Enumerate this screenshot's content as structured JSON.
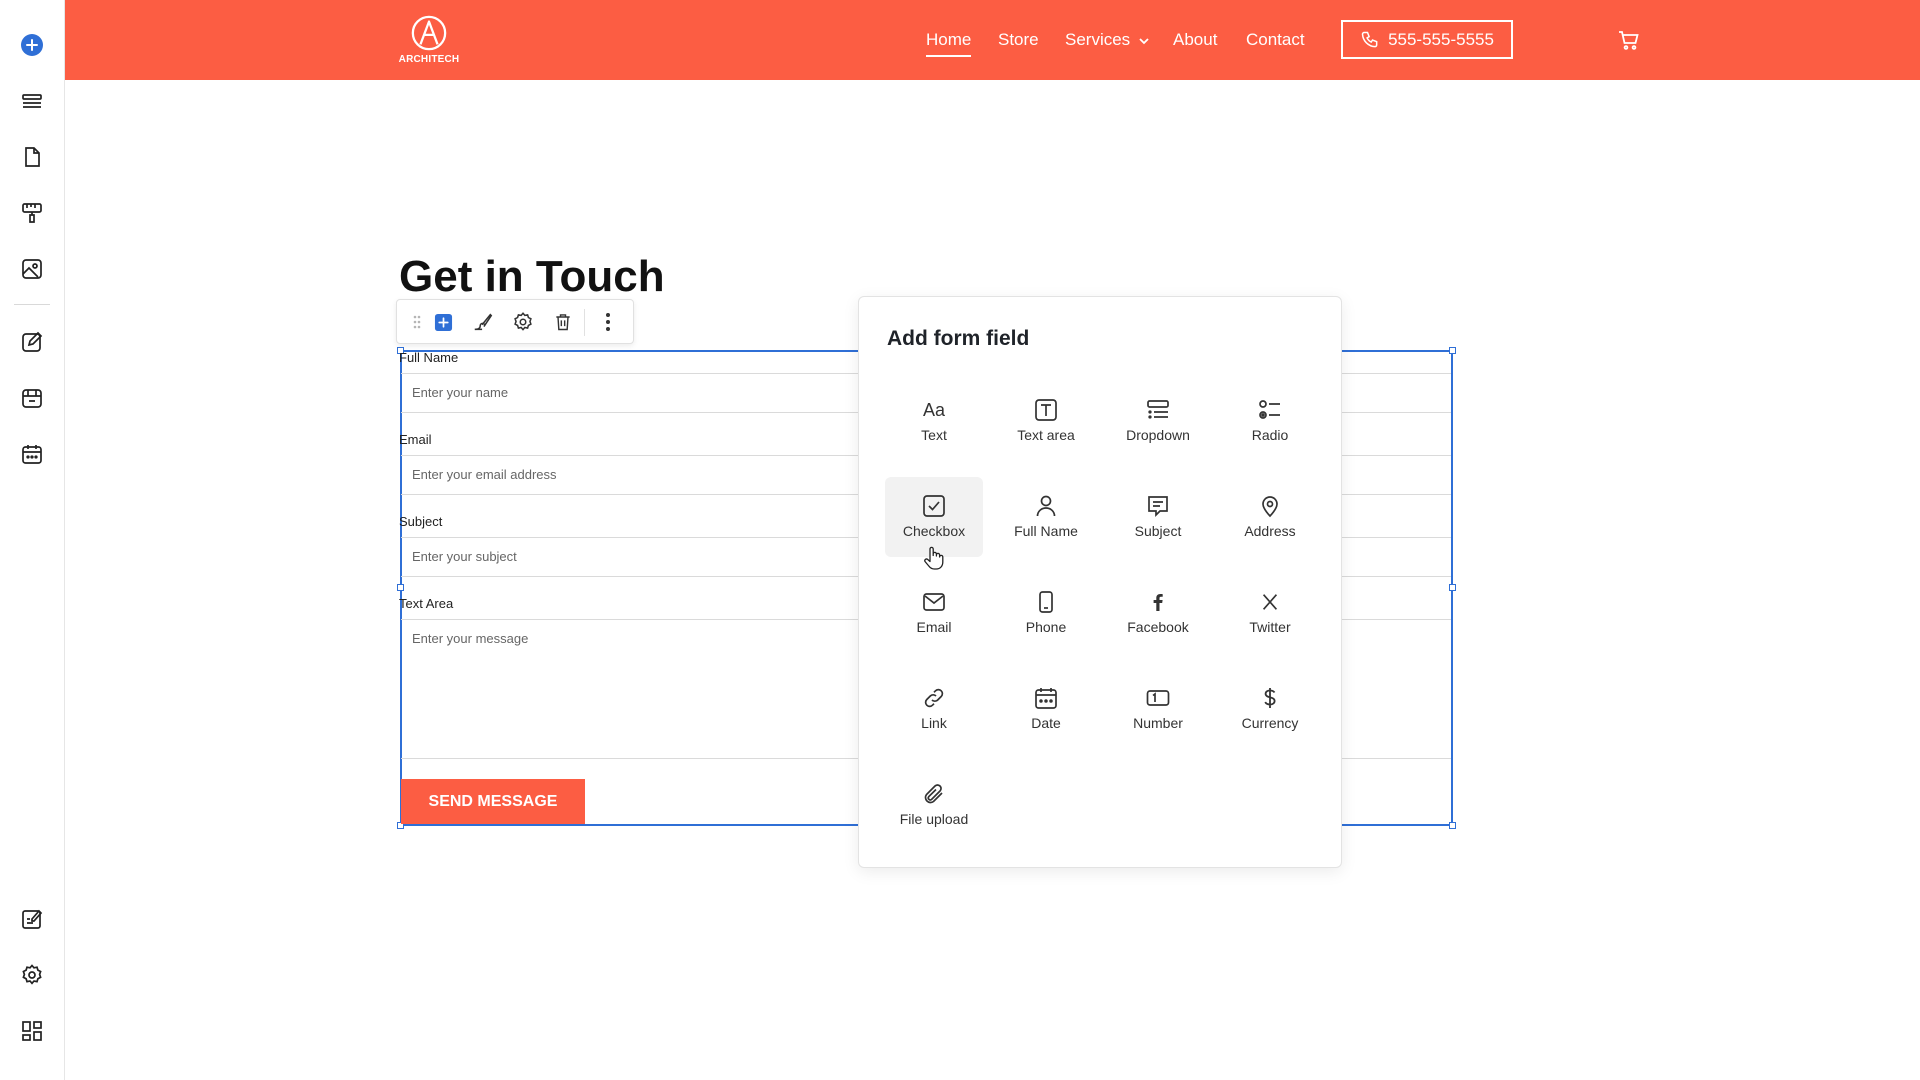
{
  "header": {
    "logo_text": "ARCHITECH",
    "nav": [
      {
        "label": "Home",
        "active": true
      },
      {
        "label": "Store"
      },
      {
        "label": "Services"
      },
      {
        "label": "About"
      },
      {
        "label": "Contact"
      }
    ],
    "phone": "555-555-5555",
    "brand_color": "#fc5d43"
  },
  "sidebar": {
    "items": [
      "add-icon",
      "layers-icon",
      "page-icon",
      "paint-roller-icon",
      "image-icon",
      "edit-icon",
      "store-icon",
      "calendar-icon",
      "blog-edit-icon",
      "settings-icon",
      "apps-icon"
    ],
    "accent": "#2f6fd6"
  },
  "main": {
    "heading": "Get in Touch",
    "form": {
      "fields": [
        {
          "label": "Full Name",
          "placeholder": "Enter your name"
        },
        {
          "label": "Email",
          "placeholder": "Enter your email address"
        },
        {
          "label": "Subject",
          "placeholder": "Enter your subject"
        },
        {
          "label": "Text Area",
          "placeholder": "Enter your message"
        }
      ],
      "submit_label": "SEND MESSAGE"
    }
  },
  "toolbar": {
    "items": [
      "drag-handle-icon",
      "add-field-icon",
      "style-brush-icon",
      "settings-icon",
      "delete-icon",
      "more-icon"
    ]
  },
  "popup": {
    "title": "Add form field",
    "fields": [
      {
        "label": "Text",
        "icon": "text-icon"
      },
      {
        "label": "Text area",
        "icon": "text-area-icon"
      },
      {
        "label": "Dropdown",
        "icon": "dropdown-icon"
      },
      {
        "label": "Radio",
        "icon": "radio-icon"
      },
      {
        "label": "Checkbox",
        "icon": "checkbox-icon",
        "hovered": true
      },
      {
        "label": "Full Name",
        "icon": "user-icon"
      },
      {
        "label": "Subject",
        "icon": "subject-icon"
      },
      {
        "label": "Address",
        "icon": "map-pin-icon"
      },
      {
        "label": "Email",
        "icon": "mail-icon"
      },
      {
        "label": "Phone",
        "icon": "phone-icon"
      },
      {
        "label": "Facebook",
        "icon": "facebook-icon"
      },
      {
        "label": "Twitter",
        "icon": "x-twitter-icon"
      },
      {
        "label": "Link",
        "icon": "link-icon"
      },
      {
        "label": "Date",
        "icon": "calendar-icon"
      },
      {
        "label": "Number",
        "icon": "number-icon"
      },
      {
        "label": "Currency",
        "icon": "dollar-icon"
      },
      {
        "label": "File upload",
        "icon": "paperclip-icon"
      }
    ]
  }
}
